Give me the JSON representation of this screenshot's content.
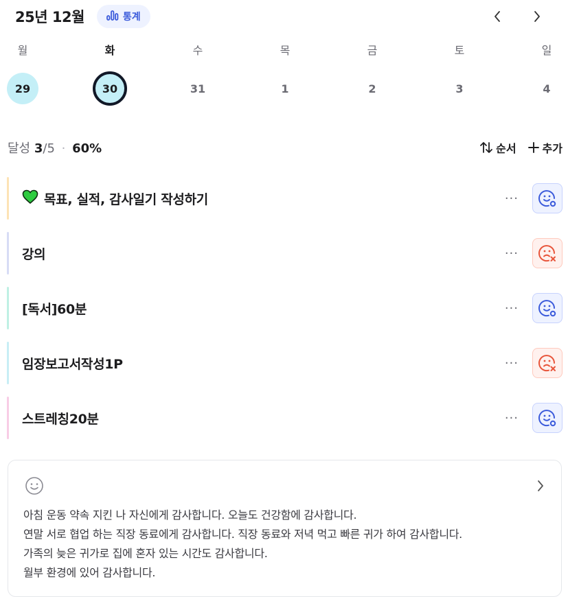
{
  "header": {
    "month": "25년 12월",
    "stats_label": "통계"
  },
  "week": {
    "days": [
      {
        "label": "월",
        "num": "29",
        "state": "done"
      },
      {
        "label": "화",
        "num": "30",
        "state": "today"
      },
      {
        "label": "수",
        "num": "31",
        "state": "none"
      },
      {
        "label": "목",
        "num": "1",
        "state": "none"
      },
      {
        "label": "금",
        "num": "2",
        "state": "none"
      },
      {
        "label": "토",
        "num": "3",
        "state": "none"
      },
      {
        "label": "일",
        "num": "4",
        "state": "none"
      }
    ]
  },
  "progress": {
    "prefix": "달성",
    "done": "3",
    "total": "/5",
    "sep": "·",
    "percent": "60%"
  },
  "actions": {
    "order_label": "순서",
    "add_label": "추가"
  },
  "tasks": [
    {
      "label": "목표, 실적, 감사일기 작성하기",
      "emoji": "💚",
      "status": "done",
      "bar_color": "#fde3b5"
    },
    {
      "label": "강의",
      "status": "failed",
      "bar_color": "#d7dcf5"
    },
    {
      "label": "[독서]60분",
      "status": "done",
      "bar_color": "#bff0e4"
    },
    {
      "label": "임장보고서작성1P",
      "status": "failed",
      "bar_color": "#c8eef5"
    },
    {
      "label": "스트레칭20분",
      "status": "done",
      "bar_color": "#f8cde6"
    }
  ],
  "journal": {
    "icon": "smile-icon",
    "lines": [
      "아침 운동 약속 지킨 나 자신에게 감사합니다. 오늘도 건강함에 감사합니다.",
      "연말 서로 협업 하는 직장 동료에게 감사합니다. 직장 동료와 저녁 먹고 빠른 귀가 하여 감사합니다.",
      "가족의 늦은 귀가로 집에 혼자 있는 시간도 감사합니다.",
      "월부 환경에 있어 감사합니다."
    ]
  },
  "colors": {
    "accent": "#3b5bdb",
    "fail": "#e8553b",
    "today_ring": "#111827",
    "day_fill": "#c4eff7"
  }
}
